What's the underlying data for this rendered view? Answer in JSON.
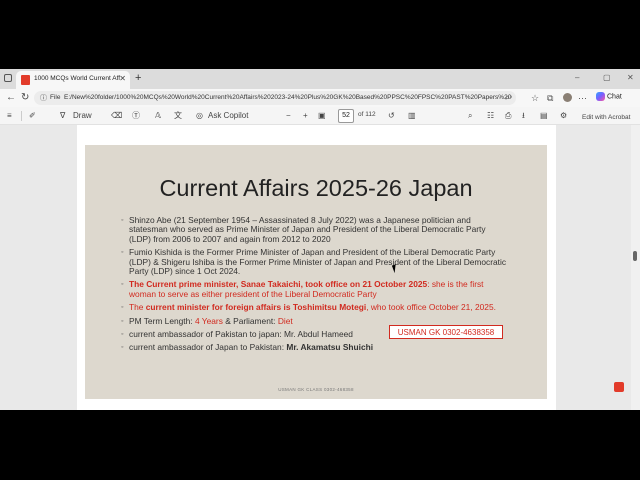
{
  "tab": {
    "title": "1000 MCQs World Current Affairs",
    "close": "✕",
    "new_tab": "+"
  },
  "window_controls": {
    "minimize": "–",
    "maximize": "▢",
    "close": "✕"
  },
  "addressbar": {
    "back": "←",
    "refresh": "↻",
    "info_icon": "ⓘ",
    "scheme_label": "File",
    "url": "E:/New%20folder/1000%20MCQs%20World%20Current%20Affairs%202023-24%20Plus%20GK%20Based%20PPSC%20FPSC%20PAST%20Papers%20Ques...",
    "chat_label": "Chat"
  },
  "pdf_toolbar": {
    "draw_label": "Draw",
    "ask_copilot_label": "Ask Copilot",
    "zoom_out": "−",
    "zoom_in": "+",
    "current_page": "52",
    "page_total": "of 112",
    "edit_label": "Edit with Acrobat"
  },
  "slide": {
    "title": "Current Affairs 2025-26 Japan",
    "b1": "Shinzo Abe (21 September 1954 – Assassinated 8 July 2022) was a Japanese politician and statesman who served as Prime Minister of Japan and President of the Liberal Democratic Party (LDP) from 2006 to 2007 and again from 2012 to 2020",
    "b2": "Fumio Kishida is the Former Prime Minister of Japan and President of the Liberal Democratic Party (LDP)  & Shigeru Ishiba is the Former Prime Minister of Japan and President of the Liberal Democratic Party (LDP) since 1 Oct 2024.",
    "b3_bold": "The Current prime minister, Sanae Takaichi, took office on 21 October 2025",
    "b3_rest": ": she is the first woman to serve as either president of the Liberal Democratic Party",
    "b4_pre": "The ",
    "b4_bold": "current minister for foreign affairs is Toshimitsu Motegi",
    "b4_rest": ", who took office October 21, 2025.",
    "b5_label": "PM Term Length: ",
    "b5_term": "4 Years",
    "b5_mid": " & Parliament: ",
    "b5_parl": "Diet",
    "b6_label": "current ambassador of Pakistan to japan:  ",
    "b6_name": " Mr. Abdul Hameed",
    "b7_label": "current ambassador of Japan to Pakistan:  ",
    "b7_name": "Mr. Akamatsu Shuichi",
    "stamp": "USMAN GK 0302-4638358",
    "footer": "USMAN GK CLASS 0302-468358"
  }
}
